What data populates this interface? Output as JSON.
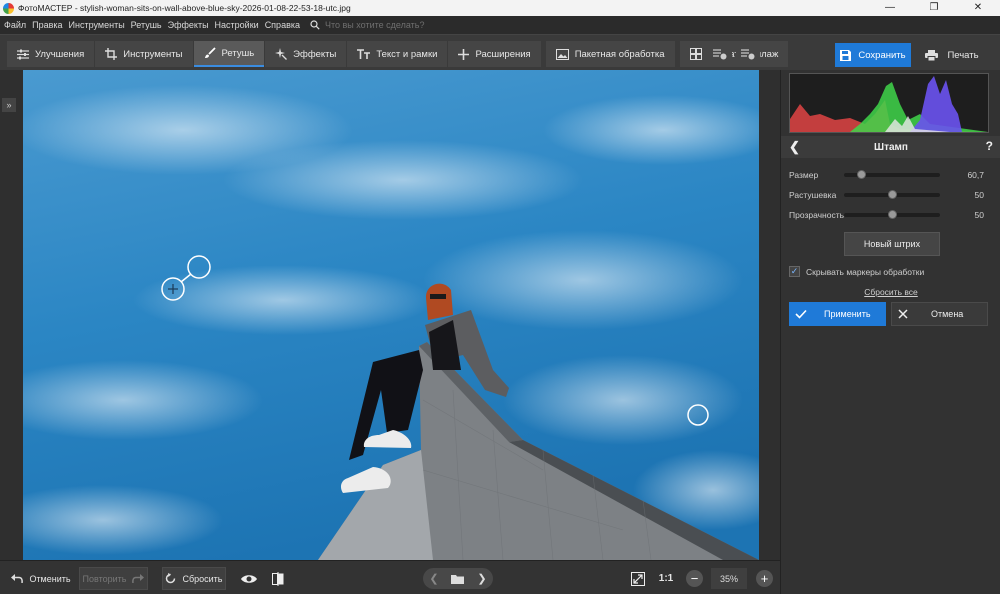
{
  "window": {
    "title": "ФотоМАСТЕР - stylish-woman-sits-on-wall-above-blue-sky-2026-01-08-22-53-18-utc.jpg",
    "minimize": "—",
    "maximize": "❐",
    "close": "✕"
  },
  "menu": {
    "items": [
      "Файл",
      "Правка",
      "Инструменты",
      "Ретушь",
      "Эффекты",
      "Настройки",
      "Справка"
    ],
    "search_placeholder": "Что вы хотите сделать?"
  },
  "tabs": [
    {
      "label": "Улучшения",
      "icon": "sliders-icon"
    },
    {
      "label": "Инструменты",
      "icon": "crop-icon"
    },
    {
      "label": "Ретушь",
      "icon": "brush-icon",
      "active": true
    },
    {
      "label": "Эффекты",
      "icon": "sparkle-icon"
    },
    {
      "label": "Текст и рамки",
      "icon": "text-icon"
    },
    {
      "label": "Расширения",
      "icon": "plus-icon"
    },
    {
      "label": "Пакетная обработка",
      "icon": "image-icon"
    },
    {
      "label": "Создать коллаж",
      "icon": "collage-icon"
    }
  ],
  "toolbar": {
    "save_label": "Сохранить",
    "print_label": "Печать"
  },
  "panel": {
    "title": "Штамп",
    "back": "❮",
    "help": "?",
    "sliders": [
      {
        "label": "Размер",
        "value": "60,7",
        "fraction": 0.18
      },
      {
        "label": "Растушевка",
        "value": "50",
        "fraction": 0.5
      },
      {
        "label": "Прозрачность",
        "value": "50",
        "fraction": 0.5
      }
    ],
    "new_stroke": "Новый штрих",
    "hide_markers_label": "Скрывать маркеры обработки",
    "hide_markers_checked": true,
    "check_mark": "✓",
    "reset_all": "Сбросить все",
    "apply": "Применить",
    "cancel": "Отмена"
  },
  "bottom": {
    "undo": "Отменить",
    "redo": "Повторить",
    "reset": "Сбросить",
    "prev": "❮",
    "next": "❯",
    "one_to_one": "1:1",
    "zoom": "35%",
    "zoom_out": "−",
    "zoom_in": "+"
  },
  "left_strip": {
    "expand": "»"
  },
  "colors": {
    "accent": "#1f7ad8",
    "sky": "#2b86c4"
  }
}
